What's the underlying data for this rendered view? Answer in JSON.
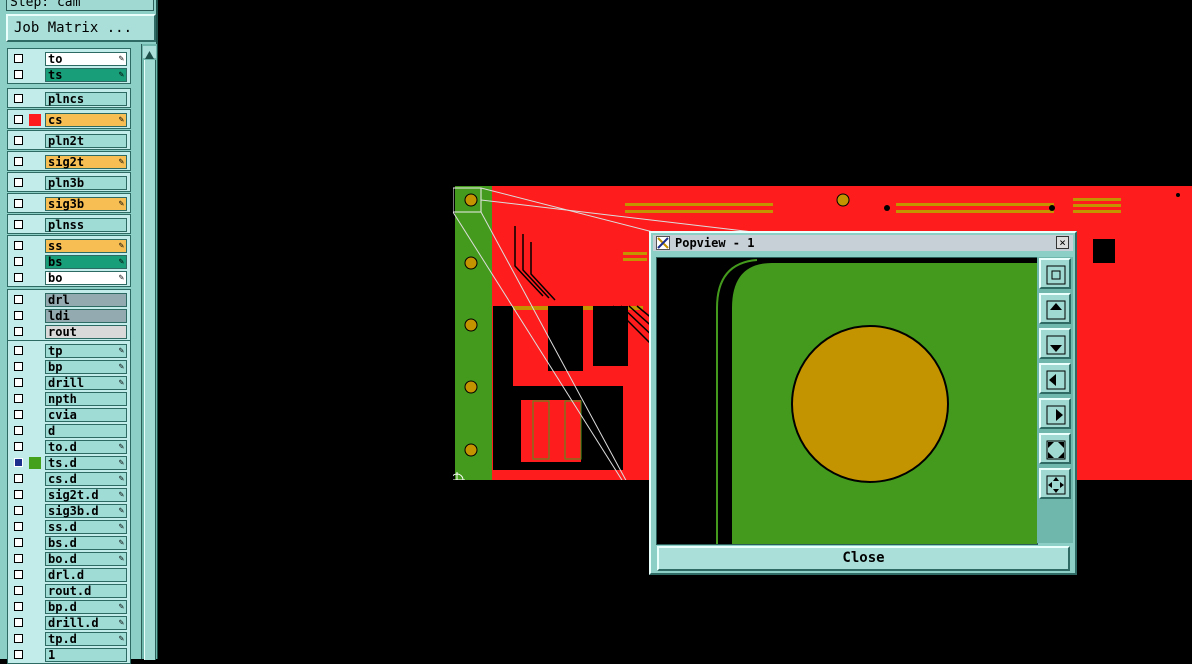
{
  "step_label": "Step: cam",
  "job_matrix_label": "Job Matrix ...",
  "layers": [
    {
      "name": "to",
      "bg": "#ffffff",
      "swatch": "",
      "checked": false,
      "icon": true
    },
    {
      "name": "ts",
      "bg": "#199e7a",
      "swatch": "",
      "checked": false,
      "icon": true
    },
    {
      "name": "plncs",
      "bg": "#9fdcd6",
      "swatch": "",
      "checked": false,
      "icon": false
    },
    {
      "name": "cs",
      "bg": "#f7bf53",
      "swatch": "#ff1c1c",
      "checked": false,
      "icon": true
    },
    {
      "name": "pln2t",
      "bg": "#9fdcd6",
      "swatch": "",
      "checked": false,
      "icon": false
    },
    {
      "name": "sig2t",
      "bg": "#f7bf53",
      "swatch": "",
      "checked": false,
      "icon": true
    },
    {
      "name": "pln3b",
      "bg": "#9fdcd6",
      "swatch": "",
      "checked": false,
      "icon": false
    },
    {
      "name": "sig3b",
      "bg": "#f7bf53",
      "swatch": "",
      "checked": false,
      "icon": true
    },
    {
      "name": "plnss",
      "bg": "#9fdcd6",
      "swatch": "",
      "checked": false,
      "icon": false
    },
    {
      "name": "ss",
      "bg": "#f7bf53",
      "swatch": "",
      "checked": false,
      "icon": true
    },
    {
      "name": "bs",
      "bg": "#199e7a",
      "swatch": "",
      "checked": false,
      "icon": true
    },
    {
      "name": "bo",
      "bg": "#ffffff",
      "swatch": "",
      "checked": false,
      "icon": true
    },
    {
      "name": "drl",
      "bg": "#93aab0",
      "swatch": "",
      "checked": false,
      "icon": false
    },
    {
      "name": "ldi",
      "bg": "#93aab0",
      "swatch": "",
      "checked": false,
      "icon": false
    },
    {
      "name": "rout",
      "bg": "#d9d9d9",
      "swatch": "",
      "checked": false,
      "icon": false
    },
    {
      "name": "tp",
      "bg": "#9fdcd6",
      "swatch": "",
      "checked": false,
      "icon": true
    },
    {
      "name": "bp",
      "bg": "#9fdcd6",
      "swatch": "",
      "checked": false,
      "icon": true
    },
    {
      "name": "drill",
      "bg": "#9fdcd6",
      "swatch": "",
      "checked": false,
      "icon": true
    },
    {
      "name": "npth",
      "bg": "#9fdcd6",
      "swatch": "",
      "checked": false,
      "icon": false
    },
    {
      "name": "cvia",
      "bg": "#9fdcd6",
      "swatch": "",
      "checked": false,
      "icon": false
    },
    {
      "name": "d",
      "bg": "#9fdcd6",
      "swatch": "",
      "checked": false,
      "icon": false
    },
    {
      "name": "to.d",
      "bg": "#9fdcd6",
      "swatch": "",
      "checked": false,
      "icon": true
    },
    {
      "name": "ts.d",
      "bg": "#9fdcd6",
      "swatch": "#44a11c",
      "checked": true,
      "icon": true
    },
    {
      "name": "cs.d",
      "bg": "#9fdcd6",
      "swatch": "",
      "checked": false,
      "icon": true
    },
    {
      "name": "sig2t.d",
      "bg": "#9fdcd6",
      "swatch": "",
      "checked": false,
      "icon": true
    },
    {
      "name": "sig3b.d",
      "bg": "#9fdcd6",
      "swatch": "",
      "checked": false,
      "icon": true
    },
    {
      "name": "ss.d",
      "bg": "#9fdcd6",
      "swatch": "",
      "checked": false,
      "icon": true
    },
    {
      "name": "bs.d",
      "bg": "#9fdcd6",
      "swatch": "",
      "checked": false,
      "icon": true
    },
    {
      "name": "bo.d",
      "bg": "#9fdcd6",
      "swatch": "",
      "checked": false,
      "icon": true
    },
    {
      "name": "drl.d",
      "bg": "#9fdcd6",
      "swatch": "",
      "checked": false,
      "icon": false
    },
    {
      "name": "rout.d",
      "bg": "#9fdcd6",
      "swatch": "",
      "checked": false,
      "icon": false
    },
    {
      "name": "bp.d",
      "bg": "#9fdcd6",
      "swatch": "",
      "checked": false,
      "icon": true
    },
    {
      "name": "drill.d",
      "bg": "#9fdcd6",
      "swatch": "",
      "checked": false,
      "icon": true
    },
    {
      "name": "tp.d",
      "bg": "#9fdcd6",
      "swatch": "",
      "checked": false,
      "icon": true
    },
    {
      "name": "1",
      "bg": "#9fdcd6",
      "swatch": "",
      "checked": false,
      "icon": false
    }
  ],
  "popview": {
    "title": "Popview - 1",
    "close_label": "Close",
    "tools": [
      "zoom-fit-icon",
      "pan-up-icon",
      "pan-down-icon",
      "pan-left-icon",
      "pan-right-icon",
      "zoom-in-icon",
      "zoom-out-icon"
    ]
  },
  "colors": {
    "board_red": "#ff1c1c",
    "board_green": "#449a1d",
    "pad_gold": "#c39300",
    "panel_bg": "#8ccfc6"
  }
}
